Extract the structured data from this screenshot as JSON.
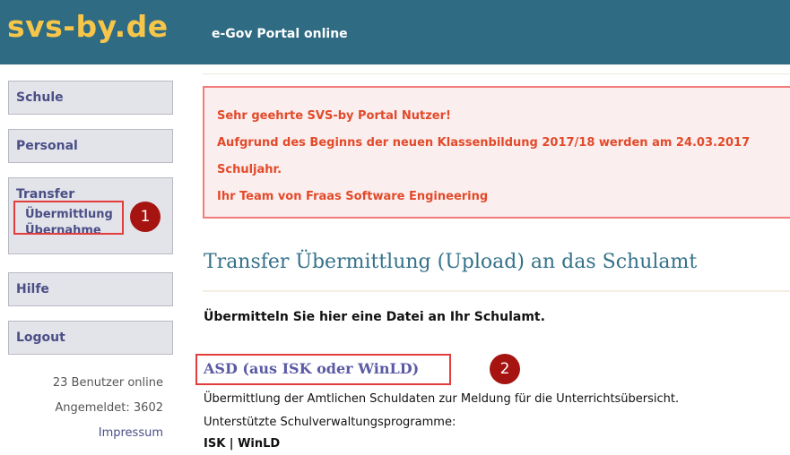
{
  "header": {
    "logo": "svs-by.de",
    "tagline": "e-Gov Portal online"
  },
  "sidebar": {
    "items": [
      {
        "label": "Schule"
      },
      {
        "label": "Personal"
      },
      {
        "label": "Transfer",
        "sub_items": [
          "Übermittlung",
          "Übernahme"
        ]
      },
      {
        "label": "Hilfe"
      },
      {
        "label": "Logout"
      }
    ],
    "users_online": "23 Benutzer online",
    "logged_in": "Angemeldet: 3602",
    "impressum": "Impressum"
  },
  "annotations": {
    "badge_1": "1",
    "badge_2": "2",
    "highlight_color": "#e23c3c",
    "badge_color": "#a51410"
  },
  "notice": {
    "line1": "Sehr geehrte SVS-by Portal Nutzer!",
    "line2": "Aufgrund des Beginns der neuen Klassenbildung 2017/18 werden am 24.03.2017",
    "line3": "Schuljahr.",
    "line4": "Ihr Team von Fraas Software Engineering"
  },
  "main": {
    "title": "Transfer Übermittlung (Upload) an das Schulamt",
    "intro": "Übermitteln Sie hier eine Datei an Ihr Schulamt.",
    "asd_link": "ASD (aus ISK oder WinLD)",
    "asd_desc": "Übermittlung der Amtlichen Schuldaten zur Meldung für die Unterrichtsübersicht.",
    "supported_label": "Unterstützte Schulverwaltungsprogramme:",
    "supported_programs": "ISK | WinLD"
  },
  "colors": {
    "header_bg": "#2f6b82",
    "logo": "#f6c64a",
    "nav_text": "#4a4f86",
    "notice_text": "#e24a2a",
    "title": "#34728a"
  }
}
